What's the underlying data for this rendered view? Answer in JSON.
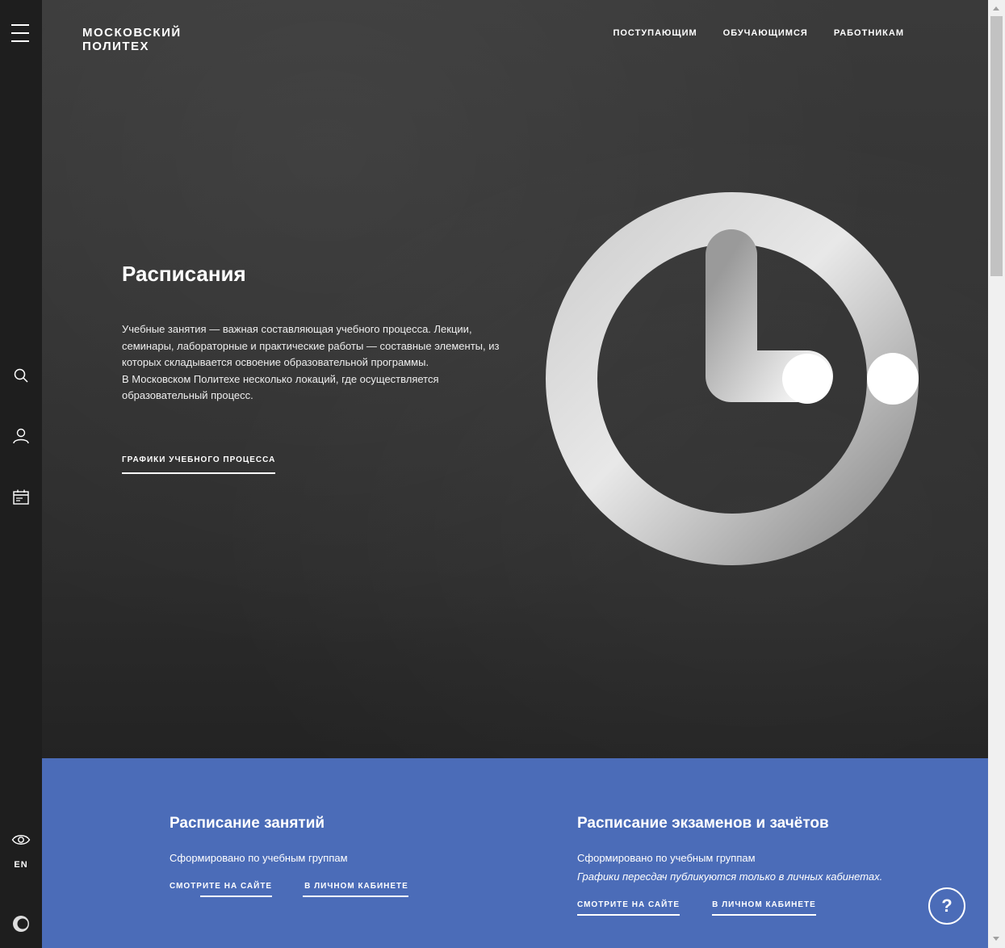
{
  "logo": {
    "line1": "Московский",
    "line2": "Политех"
  },
  "topnav": [
    "ПОСТУПАЮЩИМ",
    "ОБУЧАЮЩИМСЯ",
    "РАБОТНИКАМ"
  ],
  "rail": {
    "lang": "EN"
  },
  "hero": {
    "title": "Расписания",
    "paragraph1": "Учебные занятия — важная составляющая учебного процесса. Лекции, семинары, лабораторные и практические работы — составные элементы, из которых складывается освоение образовательной программы.",
    "paragraph2": "В Московском Политехе несколько локаций, где осуществляется образовательный процесс.",
    "link": "ГРАФИКИ УЧЕБНОГО ПРОЦЕССА"
  },
  "classes": {
    "title": "Расписание занятий",
    "subtitle": "Сформировано по учебным группам",
    "btn_site": "СМОТРИТЕ НА САЙТЕ",
    "btn_cabinet": "В ЛИЧНОМ КАБИНЕТЕ"
  },
  "exams": {
    "title": "Расписание экзаменов и зачётов",
    "subtitle": "Сформировано по учебным группам",
    "note": "Графики пересдач публикуются только в личных кабинетах.",
    "btn_site": "СМОТРИТЕ НА САЙТЕ",
    "btn_cabinet": "В ЛИЧНОМ КАБИНЕТЕ"
  },
  "help": "?",
  "colors": {
    "blue_section": "#4b6cb8",
    "rail": "#1e1e1e"
  },
  "icons": [
    "menu-icon",
    "search-icon",
    "user-icon",
    "calendar-icon",
    "eye-icon",
    "theme-icon",
    "clock-icon",
    "help-icon"
  ]
}
